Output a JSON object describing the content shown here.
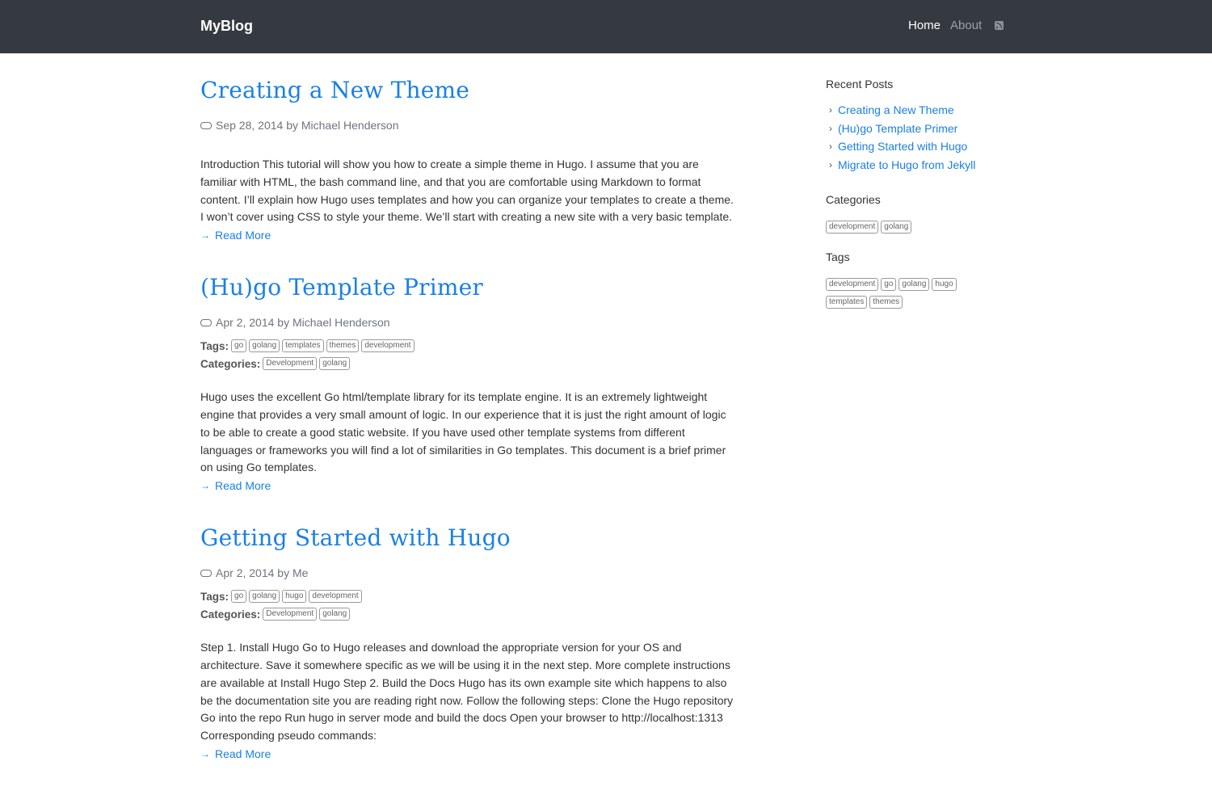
{
  "nav": {
    "brand": "MyBlog",
    "links": [
      {
        "label": "Home",
        "active": true
      },
      {
        "label": "About",
        "active": false
      }
    ],
    "rss_icon": "rss-icon"
  },
  "posts": [
    {
      "title": "Creating a New Theme",
      "date": "Sep 28, 2014",
      "by": "by",
      "author": "Michael Henderson",
      "tags": [],
      "categories": [],
      "summary": "Introduction This tutorial will show you how to create a simple theme in Hugo. I assume that you are familiar with HTML, the bash command line, and that you are comfortable using Markdown to format content. I’ll explain how Hugo uses templates and how you can organize your templates to create a theme. I won’t cover using CSS to style your theme. We’ll start with creating a new site with a very basic template.",
      "read_more": "Read More"
    },
    {
      "title": "(Hu)go Template Primer",
      "date": "Apr 2, 2014",
      "by": "by",
      "author": "Michael Henderson",
      "tags": [
        "go",
        "golang",
        "templates",
        "themes",
        "development"
      ],
      "categories": [
        "Development",
        "golang"
      ],
      "summary": "Hugo uses the excellent Go html/template library for its template engine. It is an extremely lightweight engine that provides a very small amount of logic. In our experience that it is just the right amount of logic to be able to create a good static website. If you have used other template systems from different languages or frameworks you will find a lot of similarities in Go templates. This document is a brief primer on using Go templates.",
      "read_more": "Read More"
    },
    {
      "title": "Getting Started with Hugo",
      "date": "Apr 2, 2014",
      "by": "by",
      "author": "Me",
      "tags": [
        "go",
        "golang",
        "hugo",
        "development"
      ],
      "categories": [
        "Development",
        "golang"
      ],
      "summary": "Step 1. Install Hugo Go to Hugo releases and download the appropriate version for your OS and architecture. Save it somewhere specific as we will be using it in the next step. More complete instructions are available at Install Hugo Step 2. Build the Docs Hugo has its own example site which happens to also be the documentation site you are reading right now. Follow the following steps: Clone the Hugo repository Go into the repo Run hugo in server mode and build the docs Open your browser to http://localhost:1313 Corresponding pseudo commands:",
      "read_more": "Read More"
    }
  ],
  "labels": {
    "tags": "Tags:",
    "categories": "Categories:"
  },
  "sidebar": {
    "recent_title": "Recent Posts",
    "recent": [
      "Creating a New Theme",
      "(Hu)go Template Primer",
      "Getting Started with Hugo",
      "Migrate to Hugo from Jekyll"
    ],
    "categories_title": "Categories",
    "categories": [
      "development",
      "golang"
    ],
    "tags_title": "Tags",
    "tags": [
      "development",
      "go",
      "golang",
      "hugo",
      "templates",
      "themes"
    ]
  },
  "colors": {
    "navbar": "#343a40",
    "link": "#1a80e6"
  }
}
